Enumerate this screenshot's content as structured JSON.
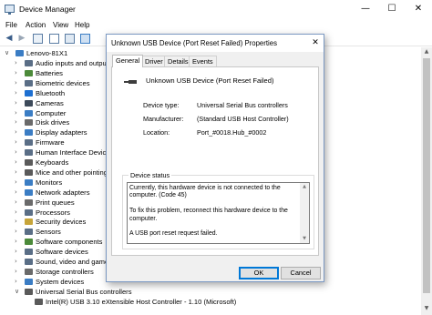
{
  "device_manager": {
    "title": "Device Manager",
    "window_controls": {
      "minimize": "—",
      "maximize": "☐",
      "close": "✕"
    },
    "menu": [
      "File",
      "Action",
      "View",
      "Help"
    ],
    "toolbar_icons": [
      "back-arrow-icon",
      "forward-arrow-icon",
      "properties-icon",
      "help-icon",
      "tree-view-icon",
      "monitor-icon"
    ],
    "tree": {
      "root": "Lenovo-81X1",
      "categories": [
        {
          "label": "Audio inputs and outputs",
          "icon": "speaker-icon",
          "color": "#5a6e86"
        },
        {
          "label": "Batteries",
          "icon": "battery-icon",
          "color": "#4c8a3a"
        },
        {
          "label": "Biometric devices",
          "icon": "fingerprint-icon",
          "color": "#5a6e86"
        },
        {
          "label": "Bluetooth",
          "icon": "bluetooth-icon",
          "color": "#1d6fd1"
        },
        {
          "label": "Cameras",
          "icon": "camera-icon",
          "color": "#3d4a5a"
        },
        {
          "label": "Computer",
          "icon": "computer-icon",
          "color": "#3b7dc4"
        },
        {
          "label": "Disk drives",
          "icon": "disk-icon",
          "color": "#6a6a6a"
        },
        {
          "label": "Display adapters",
          "icon": "display-icon",
          "color": "#3b7dc4"
        },
        {
          "label": "Firmware",
          "icon": "chip-icon",
          "color": "#5a6e86"
        },
        {
          "label": "Human Interface Devices",
          "icon": "hid-icon",
          "color": "#5a6e86"
        },
        {
          "label": "Keyboards",
          "icon": "keyboard-icon",
          "color": "#5a5a5a"
        },
        {
          "label": "Mice and other pointing",
          "icon": "mouse-icon",
          "color": "#5a5a5a"
        },
        {
          "label": "Monitors",
          "icon": "monitor-icon",
          "color": "#3b7dc4"
        },
        {
          "label": "Network adapters",
          "icon": "network-icon",
          "color": "#3b7dc4"
        },
        {
          "label": "Print queues",
          "icon": "printer-icon",
          "color": "#6a6a6a"
        },
        {
          "label": "Processors",
          "icon": "processor-icon",
          "color": "#5a6e86"
        },
        {
          "label": "Security devices",
          "icon": "security-icon",
          "color": "#c7a53a"
        },
        {
          "label": "Sensors",
          "icon": "sensor-icon",
          "color": "#5a6e86"
        },
        {
          "label": "Software components",
          "icon": "component-icon",
          "color": "#4c8a3a"
        },
        {
          "label": "Software devices",
          "icon": "software-device-icon",
          "color": "#5a6e86"
        },
        {
          "label": "Sound, video and game",
          "icon": "sound-icon",
          "color": "#5a6e86"
        },
        {
          "label": "Storage controllers",
          "icon": "storage-icon",
          "color": "#6a6a6a"
        },
        {
          "label": "System devices",
          "icon": "system-icon",
          "color": "#3b7dc4"
        },
        {
          "label": "Universal Serial Bus controllers",
          "icon": "usb-icon",
          "color": "#5a5a5a"
        }
      ],
      "usb_child": "Intel(R) USB 3.10 eXtensible Host Controller - 1.10 (Microsoft)"
    }
  },
  "dialog": {
    "title": "Unknown USB Device (Port Reset Failed) Properties",
    "close_glyph": "✕",
    "tabs": [
      "General",
      "Driver",
      "Details",
      "Events"
    ],
    "active_tab": "General",
    "device_name": "Unknown USB Device (Port Reset Failed)",
    "properties": [
      {
        "key": "Device type:",
        "value": "Universal Serial Bus controllers"
      },
      {
        "key": "Manufacturer:",
        "value": "(Standard USB Host Controller)"
      },
      {
        "key": "Location:",
        "value": "Port_#0018.Hub_#0002"
      }
    ],
    "status_label": "Device status",
    "status_text": "Currently, this hardware device is not connected to the computer. (Code 45)\n\nTo fix this problem, reconnect this hardware device to the computer.\n\nA USB port reset request failed.",
    "ok_label": "OK",
    "cancel_label": "Cancel"
  }
}
